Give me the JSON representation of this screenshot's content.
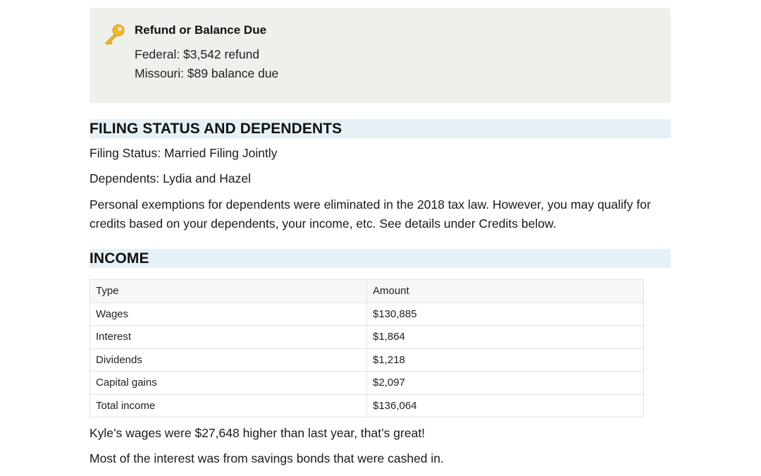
{
  "summary": {
    "title": "Refund or Balance Due",
    "icon": "key-icon",
    "federal": "Federal: $3,542 refund",
    "state": "Missouri: $89 balance due"
  },
  "filing": {
    "heading": "FILING STATUS AND DEPENDENTS",
    "status": "Filing Status: Married Filing Jointly",
    "dependents": "Dependents: Lydia and Hazel",
    "note_line1": "Personal exemptions for dependents were eliminated in the 2018 tax law. However, you may qualify for",
    "note_line2": "credits based on your dependents, your income, etc. See details under Credits below."
  },
  "income": {
    "heading": "INCOME",
    "columns": [
      "Type",
      "Amount"
    ],
    "rows": [
      {
        "type": "Wages",
        "amount": "$130,885"
      },
      {
        "type": "Interest",
        "amount": "$1,864"
      },
      {
        "type": "Dividends",
        "amount": "$1,218"
      },
      {
        "type": "Capital gains",
        "amount": "$2,097"
      },
      {
        "type": "Total income",
        "amount": "$136,064"
      }
    ],
    "note1": "Kyle’s wages were $27,648 higher than last year, that’s great!",
    "note2": "Most of the interest was from savings bonds that were cashed in."
  },
  "colors": {
    "summary_bg": "#eef0ec",
    "section_bg": "#e6f0f7",
    "key_gold": "#f2b62c"
  }
}
